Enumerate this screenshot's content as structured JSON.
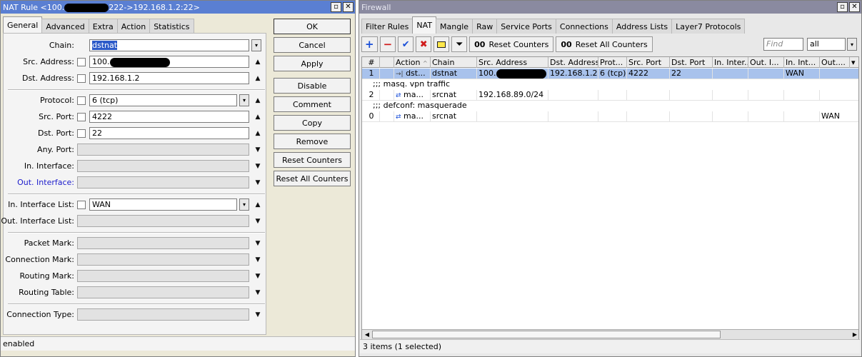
{
  "nat_window": {
    "title": "NAT Rule <100.",
    "title_tail": "222->192.168.1.2:22>",
    "tabs": [
      "General",
      "Advanced",
      "Extra",
      "Action",
      "Statistics"
    ],
    "fields": {
      "chain": {
        "label": "Chain:",
        "value": "dstnat"
      },
      "src_address": {
        "label": "Src. Address:",
        "value": "100."
      },
      "dst_address": {
        "label": "Dst. Address:",
        "value": "192.168.1.2"
      },
      "protocol": {
        "label": "Protocol:",
        "value": "6 (tcp)"
      },
      "src_port": {
        "label": "Src. Port:",
        "value": "4222"
      },
      "dst_port": {
        "label": "Dst. Port:",
        "value": "22"
      },
      "any_port": {
        "label": "Any. Port:"
      },
      "in_interface": {
        "label": "In. Interface:"
      },
      "out_interface": {
        "label": "Out. Interface:"
      },
      "in_interface_list": {
        "label": "In. Interface List:",
        "value": "WAN"
      },
      "out_interface_list": {
        "label": "Out. Interface List:"
      },
      "packet_mark": {
        "label": "Packet Mark:"
      },
      "connection_mark": {
        "label": "Connection Mark:"
      },
      "routing_mark": {
        "label": "Routing Mark:"
      },
      "routing_table": {
        "label": "Routing Table:"
      },
      "connection_type": {
        "label": "Connection Type:"
      }
    },
    "buttons": {
      "ok": "OK",
      "cancel": "Cancel",
      "apply": "Apply",
      "disable": "Disable",
      "comment": "Comment",
      "copy": "Copy",
      "remove": "Remove",
      "reset_counters": "Reset Counters",
      "reset_all_counters": "Reset All Counters"
    },
    "status": "enabled"
  },
  "firewall_window": {
    "title": "Firewall",
    "tabs": [
      "Filter Rules",
      "NAT",
      "Mangle",
      "Raw",
      "Service Ports",
      "Connections",
      "Address Lists",
      "Layer7 Protocols"
    ],
    "toolbar": {
      "reset_counters": "Reset Counters",
      "reset_all_counters": "Reset All Counters",
      "counter_prefix": "00",
      "find_placeholder": "Find",
      "filter_value": "all"
    },
    "columns": [
      "#",
      "",
      "Action",
      "Chain",
      "Src. Address",
      "Dst. Address",
      "Prot...",
      "Src. Port",
      "Dst. Port",
      "In. Inter...",
      "Out. I...",
      "In. Int...",
      "Out...."
    ],
    "rows": [
      {
        "type": "rule",
        "num": "1",
        "action": "dst...",
        "chain": "dstnat",
        "src": "100.",
        "dst": "192.168.1.2",
        "proto": "6 (tcp)",
        "sport": "4222",
        "dport": "22",
        "in_list": "WAN",
        "out_list": "",
        "selected": true
      },
      {
        "type": "comment",
        "text": ";;; masq. vpn traffic"
      },
      {
        "type": "rule",
        "num": "2",
        "action": "ma...",
        "chain": "srcnat",
        "src": "192.168.89.0/24",
        "dst": "",
        "proto": "",
        "sport": "",
        "dport": "",
        "in_list": "",
        "out_list": "",
        "selected": false
      },
      {
        "type": "comment",
        "text": ";;; defconf: masquerade"
      },
      {
        "type": "rule",
        "num": "0",
        "action": "ma...",
        "chain": "srcnat",
        "src": "",
        "dst": "",
        "proto": "",
        "sport": "",
        "dport": "",
        "in_list": "",
        "out_list": "WAN",
        "selected": false
      }
    ],
    "status": "3 items (1 selected)"
  },
  "icons": {
    "add": "plus-icon",
    "remove": "minus-icon",
    "enable": "check-icon",
    "disable": "x-icon",
    "comment": "note-icon",
    "filter": "funnel-icon",
    "min": "window-icon",
    "close": "close-icon"
  },
  "colors": {
    "titlebar_active": "#5a7fd2",
    "selection": "#a8c2ec",
    "link_label": "#1c1ccc"
  }
}
